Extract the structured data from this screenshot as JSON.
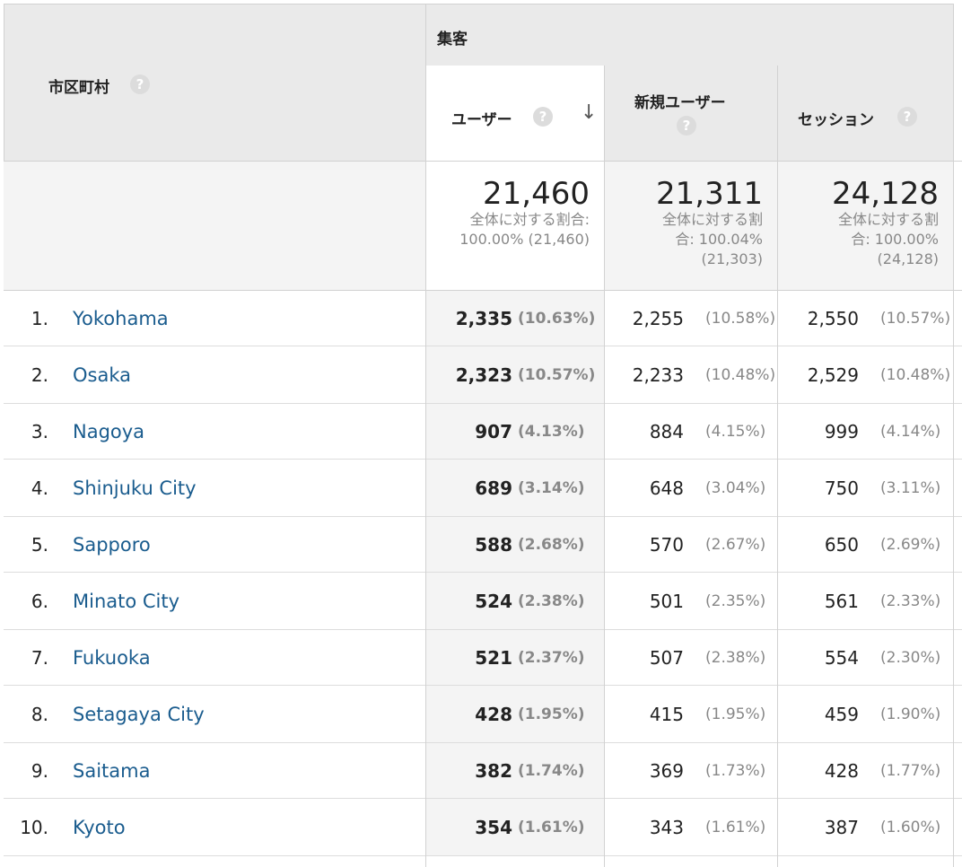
{
  "header": {
    "dimension_label": "市区町村",
    "group_label": "集客",
    "columns": {
      "users": "ユーザー",
      "new_users": "新規ユーザー",
      "sessions": "セッション"
    },
    "help_glyph": "?",
    "sort_glyph": "↓"
  },
  "totals": {
    "users": {
      "value": "21,460",
      "line1": "全体に対する割合:",
      "line2": "100.00% (21,460)"
    },
    "new_users": {
      "value": "21,311",
      "line1": "全体に対する割",
      "line2": "合: 100.04%",
      "line3": "(21,303)"
    },
    "sessions": {
      "value": "24,128",
      "line1": "全体に対する割",
      "line2": "合: 100.00%",
      "line3": "(24,128)"
    }
  },
  "rows": [
    {
      "rank": "1.",
      "city": "Yokohama",
      "users": "2,335",
      "users_pct": "(10.63%)",
      "new_users": "2,255",
      "new_users_pct": "(10.58%)",
      "sessions": "2,550",
      "sessions_pct": "(10.57%)"
    },
    {
      "rank": "2.",
      "city": "Osaka",
      "users": "2,323",
      "users_pct": "(10.57%)",
      "new_users": "2,233",
      "new_users_pct": "(10.48%)",
      "sessions": "2,529",
      "sessions_pct": "(10.48%)"
    },
    {
      "rank": "3.",
      "city": "Nagoya",
      "users": "907",
      "users_pct": "(4.13%)",
      "new_users": "884",
      "new_users_pct": "(4.15%)",
      "sessions": "999",
      "sessions_pct": "(4.14%)"
    },
    {
      "rank": "4.",
      "city": "Shinjuku City",
      "users": "689",
      "users_pct": "(3.14%)",
      "new_users": "648",
      "new_users_pct": "(3.04%)",
      "sessions": "750",
      "sessions_pct": "(3.11%)"
    },
    {
      "rank": "5.",
      "city": "Sapporo",
      "users": "588",
      "users_pct": "(2.68%)",
      "new_users": "570",
      "new_users_pct": "(2.67%)",
      "sessions": "650",
      "sessions_pct": "(2.69%)"
    },
    {
      "rank": "6.",
      "city": "Minato City",
      "users": "524",
      "users_pct": "(2.38%)",
      "new_users": "501",
      "new_users_pct": "(2.35%)",
      "sessions": "561",
      "sessions_pct": "(2.33%)"
    },
    {
      "rank": "7.",
      "city": "Fukuoka",
      "users": "521",
      "users_pct": "(2.37%)",
      "new_users": "507",
      "new_users_pct": "(2.38%)",
      "sessions": "554",
      "sessions_pct": "(2.30%)"
    },
    {
      "rank": "8.",
      "city": "Setagaya City",
      "users": "428",
      "users_pct": "(1.95%)",
      "new_users": "415",
      "new_users_pct": "(1.95%)",
      "sessions": "459",
      "sessions_pct": "(1.90%)"
    },
    {
      "rank": "9.",
      "city": "Saitama",
      "users": "382",
      "users_pct": "(1.74%)",
      "new_users": "369",
      "new_users_pct": "(1.73%)",
      "sessions": "428",
      "sessions_pct": "(1.77%)"
    },
    {
      "rank": "10.",
      "city": "Kyoto",
      "users": "354",
      "users_pct": "(1.61%)",
      "new_users": "343",
      "new_users_pct": "(1.61%)",
      "sessions": "387",
      "sessions_pct": "(1.60%)"
    }
  ]
}
